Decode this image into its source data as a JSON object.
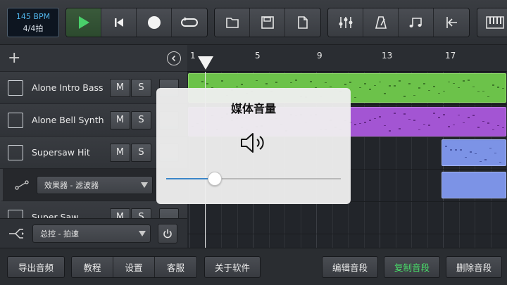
{
  "transport": {
    "bpm": "145 BPM",
    "time_signature": "4/4拍"
  },
  "toolbar": {
    "group1": [
      "play-icon",
      "skip-to-start-icon",
      "record-icon",
      "loop-icon"
    ],
    "group2": [
      "folder-icon",
      "save-icon",
      "new-file-icon"
    ],
    "group3": [
      "mixer-icon",
      "metronome-icon",
      "music-notes-icon",
      "marker-icon"
    ],
    "group4": [
      "piano-icon"
    ],
    "accent": "#49d06a"
  },
  "tracks": [
    {
      "name": "Alone Intro Bass",
      "mute": "M",
      "solo": "S"
    },
    {
      "name": "Alone Bell Synth",
      "mute": "M",
      "solo": "S"
    },
    {
      "name": "Supersaw Hit",
      "mute": "M",
      "solo": "S"
    },
    {
      "name": "Super Saw",
      "mute": "M",
      "solo": "S"
    }
  ],
  "effect_row": {
    "select_value": "效果器 - 滤波器"
  },
  "master": {
    "select_value": "总控 - 拍速"
  },
  "ruler": {
    "marks": [
      "1",
      "5",
      "9",
      "13",
      "17"
    ]
  },
  "overlay": {
    "title": "媒体音量",
    "volume_fraction": 0.28
  },
  "bottom": {
    "export": "导出音频",
    "tutorial": "教程",
    "settings": "设置",
    "support": "客服",
    "about": "关于软件",
    "edit_clip": "编辑音段",
    "copy_clip": "复制音段",
    "delete_clip": "删除音段"
  },
  "colors": {
    "clip_green": "#6cc24a",
    "clip_purple": "#a355d3",
    "clip_blue": "#7c93e6",
    "slider_blue": "#3b86c9"
  }
}
